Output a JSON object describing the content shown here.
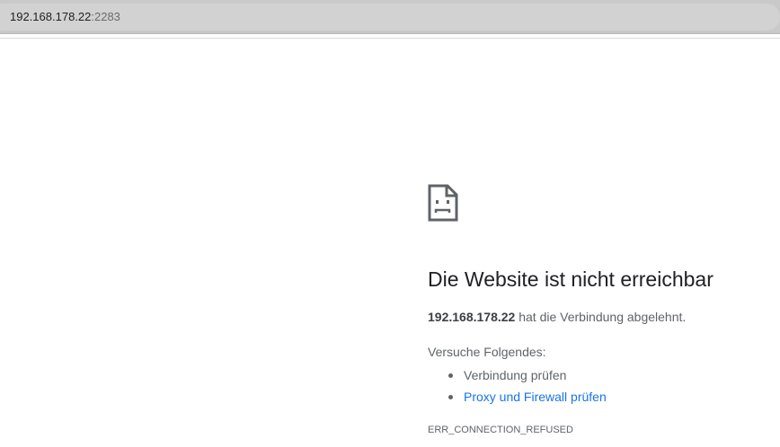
{
  "address_bar": {
    "host": "192.168.178.22",
    "port": ":2283"
  },
  "error_page": {
    "icon": "sad-page-icon",
    "title": "Die Website ist nicht erreichbar",
    "host": "192.168.178.22",
    "message": " hat die Verbindung abgelehnt.",
    "tips_heading": "Versuche Folgendes:",
    "tips": [
      "Verbindung prüfen",
      "Proxy und Firewall prüfen"
    ],
    "error_code": "ERR_CONNECTION_REFUSED",
    "colors": {
      "text": "#202124",
      "secondary_text": "#5f6368",
      "link": "#1a73e8"
    }
  }
}
